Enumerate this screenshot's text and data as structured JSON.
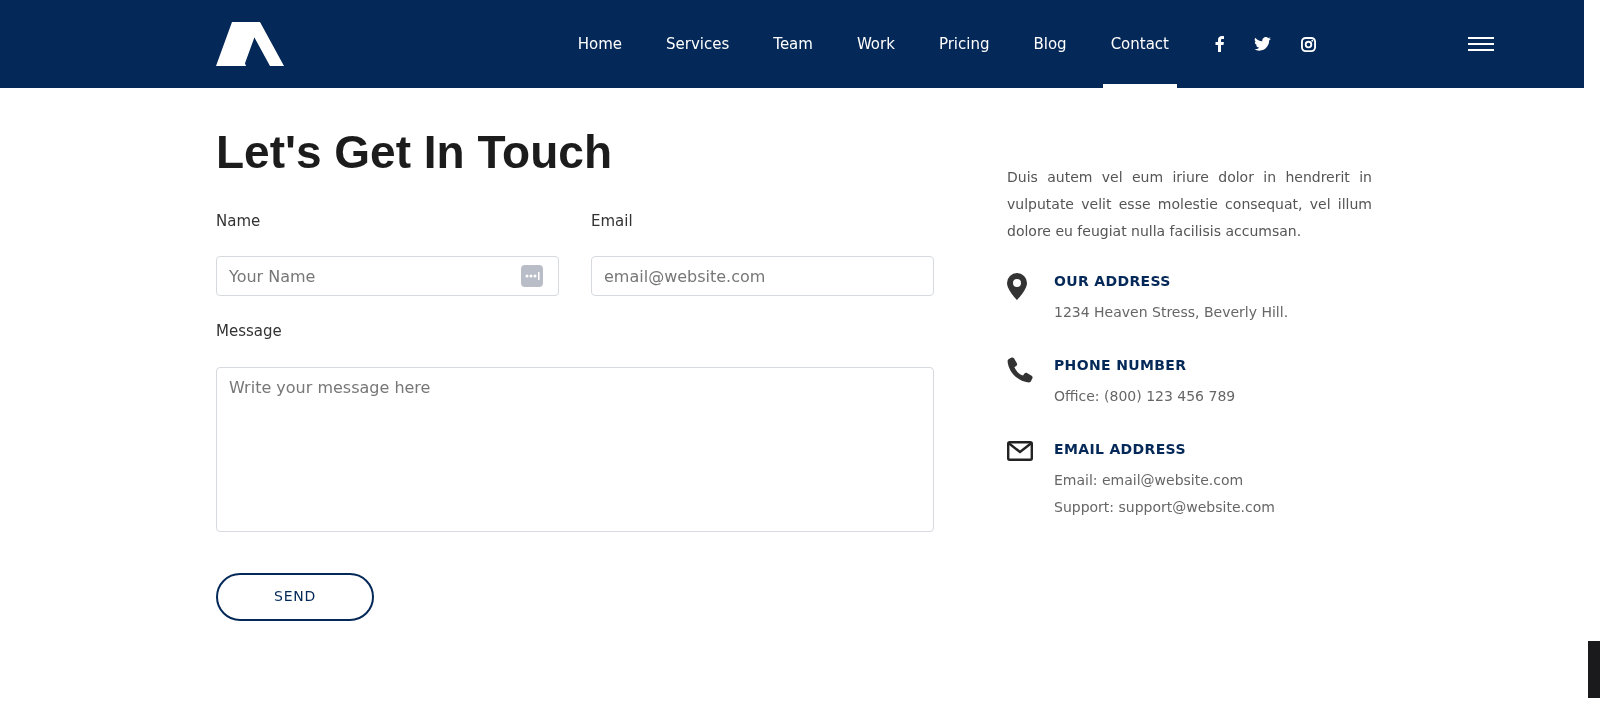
{
  "nav": [
    {
      "label": "Home",
      "selected": false
    },
    {
      "label": "Services",
      "selected": false
    },
    {
      "label": "Team",
      "selected": false
    },
    {
      "label": "Work",
      "selected": false
    },
    {
      "label": "Pricing",
      "selected": false
    },
    {
      "label": "Blog",
      "selected": false
    },
    {
      "label": "Contact",
      "selected": true
    }
  ],
  "social": [
    {
      "kind": "facebook"
    },
    {
      "kind": "twitter"
    },
    {
      "kind": "instagram"
    }
  ],
  "heading": "Let's Get In Touch",
  "form": {
    "name_label": "Name",
    "name_placeholder": "Your Name",
    "email_label": "Email",
    "email_placeholder": "email@website.com",
    "message_label": "Message",
    "message_placeholder": "Write your message here",
    "send": "SEND"
  },
  "intro": "Duis autem vel eum iriure dolor in hendrerit in vulputate velit esse molestie consequat, vel illum dolore eu feugiat nulla facilisis accumsan.",
  "contacts": [
    {
      "kind": "address",
      "title": "OUR ADDRESS",
      "lines": [
        "1234 Heaven Stress, Beverly Hill."
      ]
    },
    {
      "kind": "phone",
      "title": "PHONE NUMBER",
      "lines": [
        "Office: (800) 123 456 789"
      ]
    },
    {
      "kind": "email",
      "title": "EMAIL ADDRESS",
      "lines": [
        "Email: email@website.com",
        "Support: support@website.com"
      ]
    }
  ]
}
